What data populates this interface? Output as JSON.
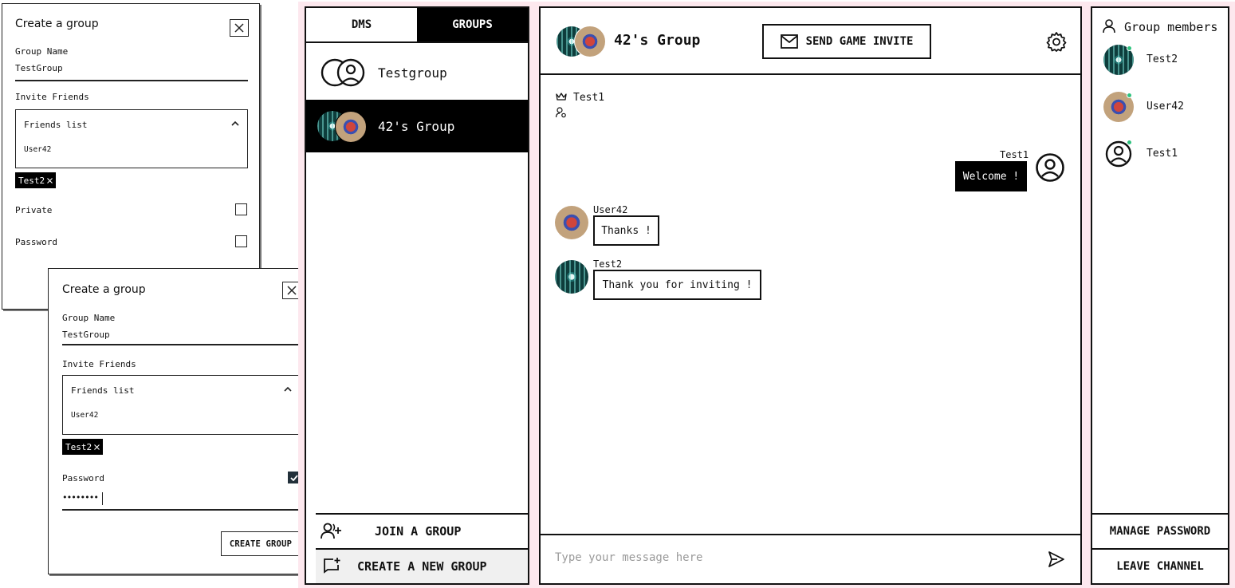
{
  "modal_a": {
    "title": "Create a group",
    "group_name_label": "Group Name",
    "group_name_value": "TestGroup",
    "invite_label": "Invite Friends",
    "friends_list_label": "Friends list",
    "friends": [
      "User42"
    ],
    "selected_chip": "Test2",
    "private_label": "Private",
    "private_checked": false,
    "password_label": "Password",
    "password_checked": false
  },
  "modal_b": {
    "title": "Create a group",
    "group_name_label": "Group Name",
    "group_name_value": "TestGroup",
    "invite_label": "Invite Friends",
    "friends_list_label": "Friends list",
    "friends": [
      "User42"
    ],
    "selected_chip": "Test2",
    "password_label": "Password",
    "password_checked": true,
    "password_value": "••••••••",
    "create_button": "CREATE GROUP"
  },
  "sidebar": {
    "tabs": [
      {
        "label": "DMS",
        "active": false
      },
      {
        "label": "GROUPS",
        "active": true
      }
    ],
    "groups": [
      {
        "name": "Testgroup",
        "selected": false
      },
      {
        "name": "42's Group",
        "selected": true
      }
    ],
    "join_label": "JOIN A GROUP",
    "create_label": "CREATE A NEW GROUP"
  },
  "chat": {
    "title": "42's Group",
    "invite_button": "SEND GAME INVITE",
    "owner": "Test1",
    "messages": [
      {
        "author": "Test1",
        "text": "Welcome !",
        "outgoing": true
      },
      {
        "author": "User42",
        "text": "Thanks !",
        "outgoing": false
      },
      {
        "author": "Test2",
        "text": "Thank you for inviting !",
        "outgoing": false
      }
    ],
    "composer_placeholder": "Type your message here"
  },
  "members": {
    "title": "Group members",
    "list": [
      {
        "name": "Test2",
        "online": true
      },
      {
        "name": "User42",
        "online": true
      },
      {
        "name": "Test1",
        "online": true
      }
    ],
    "manage_password": "MANAGE PASSWORD",
    "leave_channel": "LEAVE CHANNEL"
  },
  "colors": {
    "background_tint": "#fde8ee",
    "accent": "#000000",
    "online": "#2ec27e",
    "checkbox_checked": "#22303a"
  }
}
